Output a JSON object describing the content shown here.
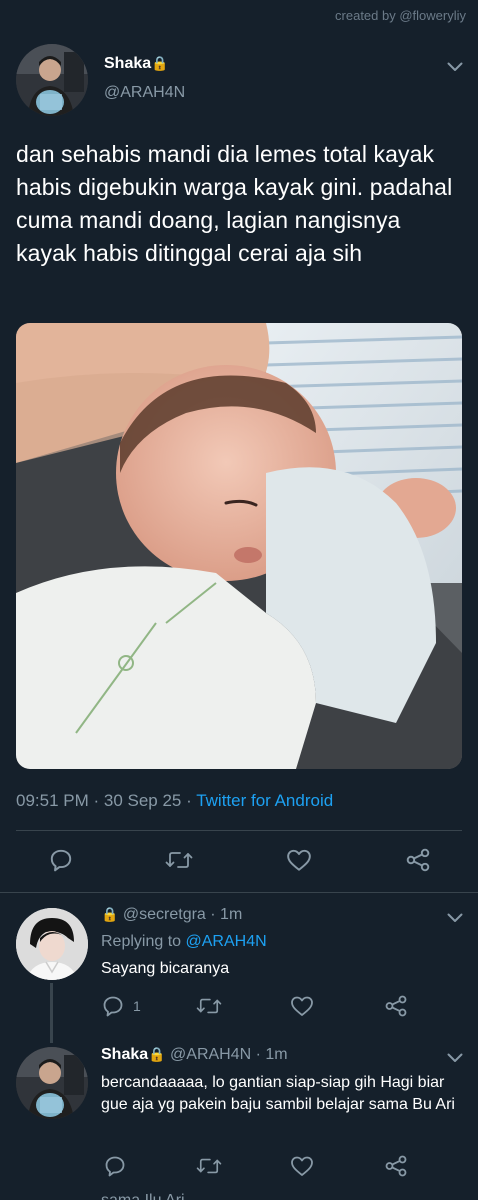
{
  "watermark": "created by @floweryliy",
  "main_tweet": {
    "name": "Shaka",
    "lock_icon": "🔒",
    "handle": "@ARAH4N",
    "text": "dan sehabis mandi dia lemes total kayak habis digebukin warga kayak gini. padahal cuma mandi doang, lagian nangisnya kayak habis ditinggal cerai aja sih",
    "time": "09:51 PM · 30 Sep 25 · ",
    "source": "Twitter for Android",
    "actions": [
      "reply-icon",
      "retweet-icon",
      "like-icon",
      "share-icon"
    ]
  },
  "replies": [
    {
      "lock_icon": "🔒",
      "name": "",
      "handle": "@secretgra",
      "time": " · 1m",
      "replying_label": "Replying to ",
      "replying_handle": "@ARAH4N",
      "text": "Sayang bicaranya",
      "reply_count": "1"
    },
    {
      "name": "Shaka",
      "lock_icon": "🔒",
      "handle": "@ARAH4N",
      "time": " · 1m",
      "text": "bercandaaaaa, lo gantian siap-siap gih Hagi biar gue aja yg pakein baju sambil belajar sama Bu Ari",
      "reply_count": ""
    }
  ],
  "cutoff_text": "sama Ilu Ari"
}
